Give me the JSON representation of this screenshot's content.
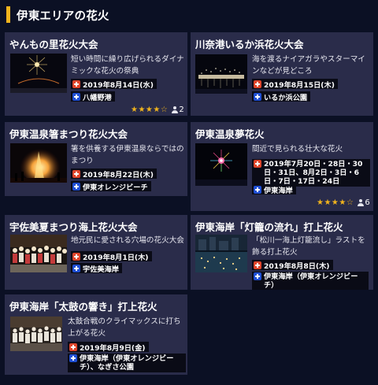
{
  "header": {
    "title": "伊東エリアの花火"
  },
  "cards": [
    {
      "title": "やんもの里花火大会",
      "description": "短い時間に繰り広げられるダイナミックな花火の祭典",
      "date": "2019年8月14日(水)",
      "place": "八幡野港",
      "rating": {
        "stars": "★★★★☆",
        "count": "2"
      },
      "thumbnail": "single-firework-burst"
    },
    {
      "title": "川奈港いるか浜花火大会",
      "description": "海を渡るナイアガラやスターマインなどが見どころ",
      "date": "2019年8月15日(木)",
      "place": "いるか浜公園",
      "thumbnail": "niagara-fireworks-over-sea"
    },
    {
      "title": "伊東温泉箸まつり花火大会",
      "description": "箸を供養する伊東温泉ならではのまつり",
      "date": "2019年8月22日(木)",
      "place": "伊東オレンジビーチ",
      "thumbnail": "bonfire-festival"
    },
    {
      "title": "伊東温泉夢花火",
      "description": "間近で見られる壮大な花火",
      "date": "2019年7月20日・28日・30日・31日、8月2日・3日・6日・7日・17日・24日",
      "place": "伊東海岸",
      "rating": {
        "stars": "★★★★☆",
        "count": "6"
      },
      "thumbnail": "colorful-firework-burst"
    },
    {
      "title": "宇佐美夏まつり海上花火大会",
      "description": "地元民に愛される穴場の花火大会",
      "date": "2019年8月1日(木)",
      "place": "宇佐美海岸",
      "thumbnail": "festival-crowd"
    },
    {
      "title": "伊東海岸「灯籠の流れ」打上花火",
      "description": "「松川一海上灯籠流し」ラストを飾る打上花火",
      "date": "2019年8月8日(木)",
      "place": "伊東海岸（伊東オレンジビーチ）",
      "thumbnail": "lanterns-on-river"
    },
    {
      "title": "伊東海岸「太鼓の響き」打上花火",
      "description": "太鼓合戦のクライマックスに打ち上がる花火",
      "date": "2019年8月9日(金)",
      "place": "伊東海岸（伊東オレンジビーチ）、なぎさ公園",
      "thumbnail": "taiko-drum-crowd"
    }
  ],
  "colors": {
    "background": "#0b1024",
    "card": "#2a2c4a",
    "accent": "#f0b31d",
    "date_icon": "#e0452b",
    "place_icon": "#1f4fd4"
  }
}
